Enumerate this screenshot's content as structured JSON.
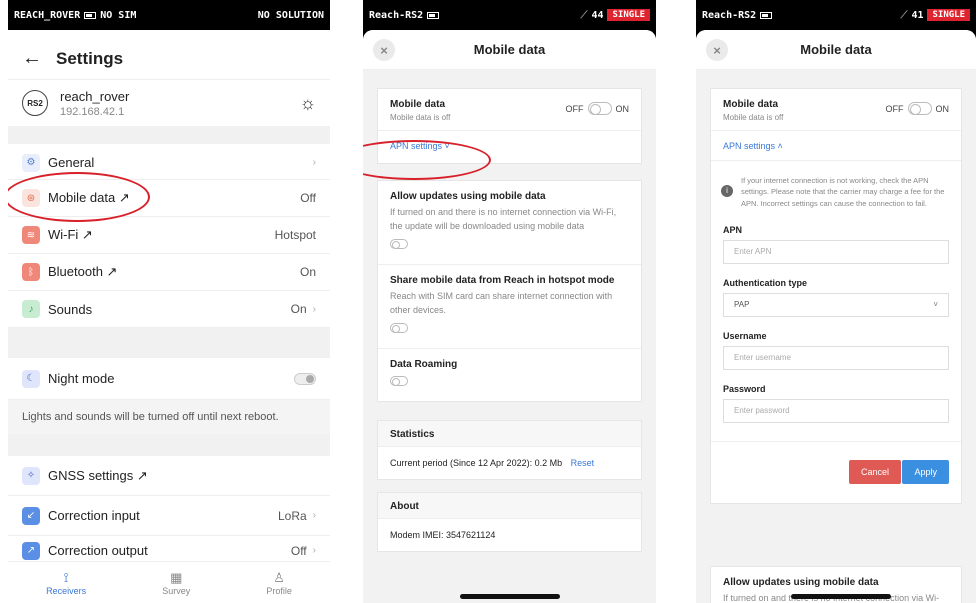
{
  "phone1": {
    "status": {
      "carrier": "REACH_ROVER",
      "sim": "NO SIM",
      "solution": "NO SOLUTION"
    },
    "header": {
      "back": "←",
      "title": "Settings"
    },
    "device": {
      "badge": "RS2",
      "name": "reach_rover",
      "ip": "192.168.42.1"
    },
    "rows": {
      "general": {
        "label": "General",
        "value": "",
        "chevron": "›"
      },
      "mobile": {
        "label": "Mobile data ↗",
        "value": "Off"
      },
      "wifi": {
        "label": "Wi-Fi ↗",
        "value": "Hotspot"
      },
      "bluetooth": {
        "label": "Bluetooth ↗",
        "value": "On"
      },
      "sounds": {
        "label": "Sounds",
        "value": "On",
        "chevron": "›"
      },
      "night": {
        "label": "Night mode"
      },
      "night_note": "Lights and sounds will be turned off until next reboot.",
      "gnss": {
        "label": "GNSS settings ↗"
      },
      "correction_in": {
        "label": "Correction input",
        "value": "LoRa",
        "chevron": "›"
      },
      "correction_out": {
        "label": "Correction output",
        "value": "Off",
        "chevron": "›"
      }
    },
    "nav": {
      "receivers": "Receivers",
      "survey": "Survey",
      "profile": "Profile"
    }
  },
  "phone2": {
    "status": {
      "device": "Reach-RS2",
      "sat": "44",
      "mode": "SINGLE"
    },
    "title": "Mobile data",
    "close": "×",
    "mobile": {
      "label": "Mobile data",
      "sub": "Mobile data is off",
      "off": "OFF",
      "on": "ON"
    },
    "apn_link": "APN settings ˅",
    "allow": {
      "label": "Allow updates using mobile data",
      "sub": "If turned on and there is no internet connection via Wi-Fi, the update will be downloaded using mobile data"
    },
    "share": {
      "label": "Share mobile data from Reach in hotspot mode",
      "sub": "Reach with SIM card can share internet connection with other devices."
    },
    "roaming": {
      "label": "Data Roaming"
    },
    "stats": {
      "title": "Statistics",
      "text": "Current period (Since 12 Apr 2022): 0.2 Mb",
      "reset": "Reset"
    },
    "about": {
      "title": "About",
      "text": "Modem IMEI: 3547621124"
    }
  },
  "phone3": {
    "status": {
      "device": "Reach-RS2",
      "sat": "41",
      "mode": "SINGLE"
    },
    "title": "Mobile data",
    "close": "×",
    "mobile": {
      "label": "Mobile data",
      "sub": "Mobile data is off",
      "off": "OFF",
      "on": "ON"
    },
    "apn_link": "APN settings ˄",
    "info": "If your internet connection is not working, check the APN settings. Please note that the carrier may charge a fee for the APN. Incorrect settings can cause the connection to fail.",
    "apn": {
      "label": "APN",
      "placeholder": "Enter APN"
    },
    "auth": {
      "label": "Authentication type",
      "value": "PAP"
    },
    "user": {
      "label": "Username",
      "placeholder": "Enter username"
    },
    "pass": {
      "label": "Password",
      "placeholder": "Enter password"
    },
    "cancel": "Cancel",
    "apply": "Apply",
    "allow": {
      "label": "Allow updates using mobile data",
      "sub": "If turned on and there is no internet connection via Wi-Fi, the update will be downloaded using mobile data"
    }
  },
  "colors": {
    "accent": "#3a78d8",
    "annotation": "#d8202a",
    "single_badge": "#e0242f",
    "cancel": "#e05a55",
    "apply": "#3b8fe0"
  }
}
